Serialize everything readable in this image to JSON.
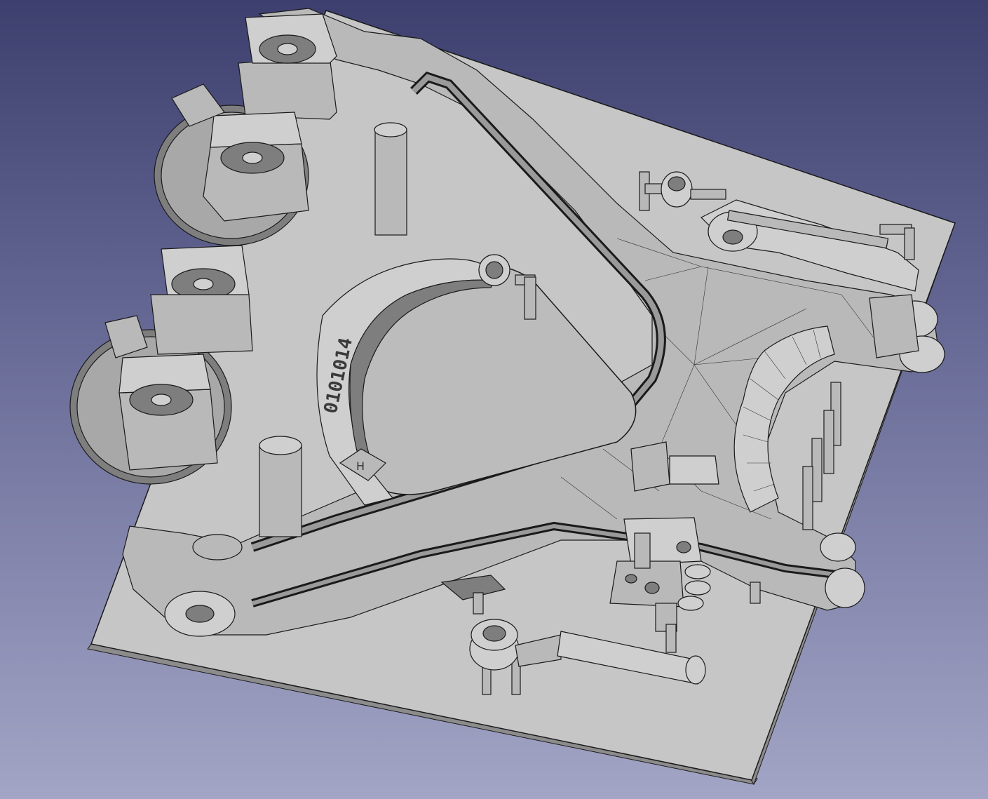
{
  "viewport": {
    "background_top": "#3d3f6e",
    "background_bottom": "#a3a5c6",
    "model_color": "#c6c6c6",
    "mesh_line_color": "#1a1a1a"
  },
  "model": {
    "engraved_text": "0101014",
    "hex_logo_letter": "H"
  }
}
